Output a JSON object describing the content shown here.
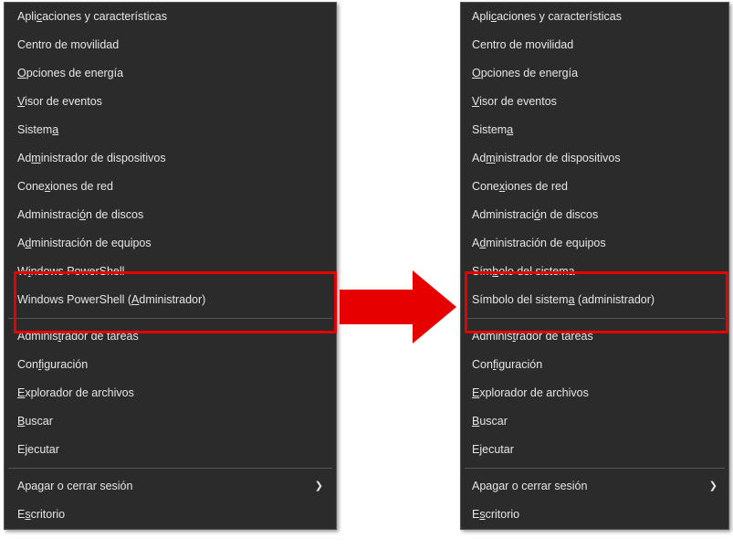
{
  "left_menu": [
    {
      "label": "Aplicaciones y características",
      "ak": "c",
      "submenu": false
    },
    {
      "label": "Centro de movilidad",
      "ak": "",
      "submenu": false
    },
    {
      "label": "Opciones de energía",
      "ak": "O",
      "submenu": false
    },
    {
      "label": "Visor de eventos",
      "ak": "V",
      "submenu": false
    },
    {
      "label": "Sistema",
      "ak": "a",
      "submenu": false
    },
    {
      "label": "Administrador de dispositivos",
      "ak": "m",
      "submenu": false
    },
    {
      "label": "Conexiones de red",
      "ak": "x",
      "submenu": false
    },
    {
      "label": "Administración de discos",
      "ak": "ó",
      "submenu": false
    },
    {
      "label": "Administración de equipos",
      "ak": "d",
      "submenu": false
    },
    {
      "label": "Windows PowerShell",
      "ak": "i",
      "submenu": false
    },
    {
      "label": "Windows PowerShell (Administrador)",
      "ak": "A",
      "submenu": false
    },
    "sep",
    {
      "label": "Administrador de tareas",
      "ak": "t",
      "submenu": false
    },
    {
      "label": "Configuración",
      "ak": "f",
      "submenu": false
    },
    {
      "label": "Explorador de archivos",
      "ak": "E",
      "submenu": false
    },
    {
      "label": "Buscar",
      "ak": "B",
      "submenu": false
    },
    {
      "label": "Ejecutar",
      "ak": "j",
      "submenu": false
    },
    "sep",
    {
      "label": "Apagar o cerrar sesión",
      "ak": "g",
      "submenu": true
    },
    {
      "label": "Escritorio",
      "ak": "s",
      "submenu": false
    }
  ],
  "right_menu": [
    {
      "label": "Aplicaciones y características",
      "ak": "c",
      "submenu": false
    },
    {
      "label": "Centro de movilidad",
      "ak": "",
      "submenu": false
    },
    {
      "label": "Opciones de energía",
      "ak": "O",
      "submenu": false
    },
    {
      "label": "Visor de eventos",
      "ak": "V",
      "submenu": false
    },
    {
      "label": "Sistema",
      "ak": "a",
      "submenu": false
    },
    {
      "label": "Administrador de dispositivos",
      "ak": "m",
      "submenu": false
    },
    {
      "label": "Conexiones de red",
      "ak": "x",
      "submenu": false
    },
    {
      "label": "Administración de discos",
      "ak": "ó",
      "submenu": false
    },
    {
      "label": "Administración de equipos",
      "ak": "d",
      "submenu": false
    },
    {
      "label": "Símbolo del sistema",
      "ak": "b",
      "submenu": false
    },
    {
      "label": "Símbolo del sistema (administrador)",
      "ak": "a",
      "submenu": false
    },
    "sep",
    {
      "label": "Administrador de tareas",
      "ak": "t",
      "submenu": false
    },
    {
      "label": "Configuración",
      "ak": "f",
      "submenu": false
    },
    {
      "label": "Explorador de archivos",
      "ak": "E",
      "submenu": false
    },
    {
      "label": "Buscar",
      "ak": "B",
      "submenu": false
    },
    {
      "label": "Ejecutar",
      "ak": "j",
      "submenu": false
    },
    "sep",
    {
      "label": "Apagar o cerrar sesión",
      "ak": "g",
      "submenu": true
    },
    {
      "label": "Escritorio",
      "ak": "s",
      "submenu": false
    }
  ],
  "arrow_glyph": "❯"
}
